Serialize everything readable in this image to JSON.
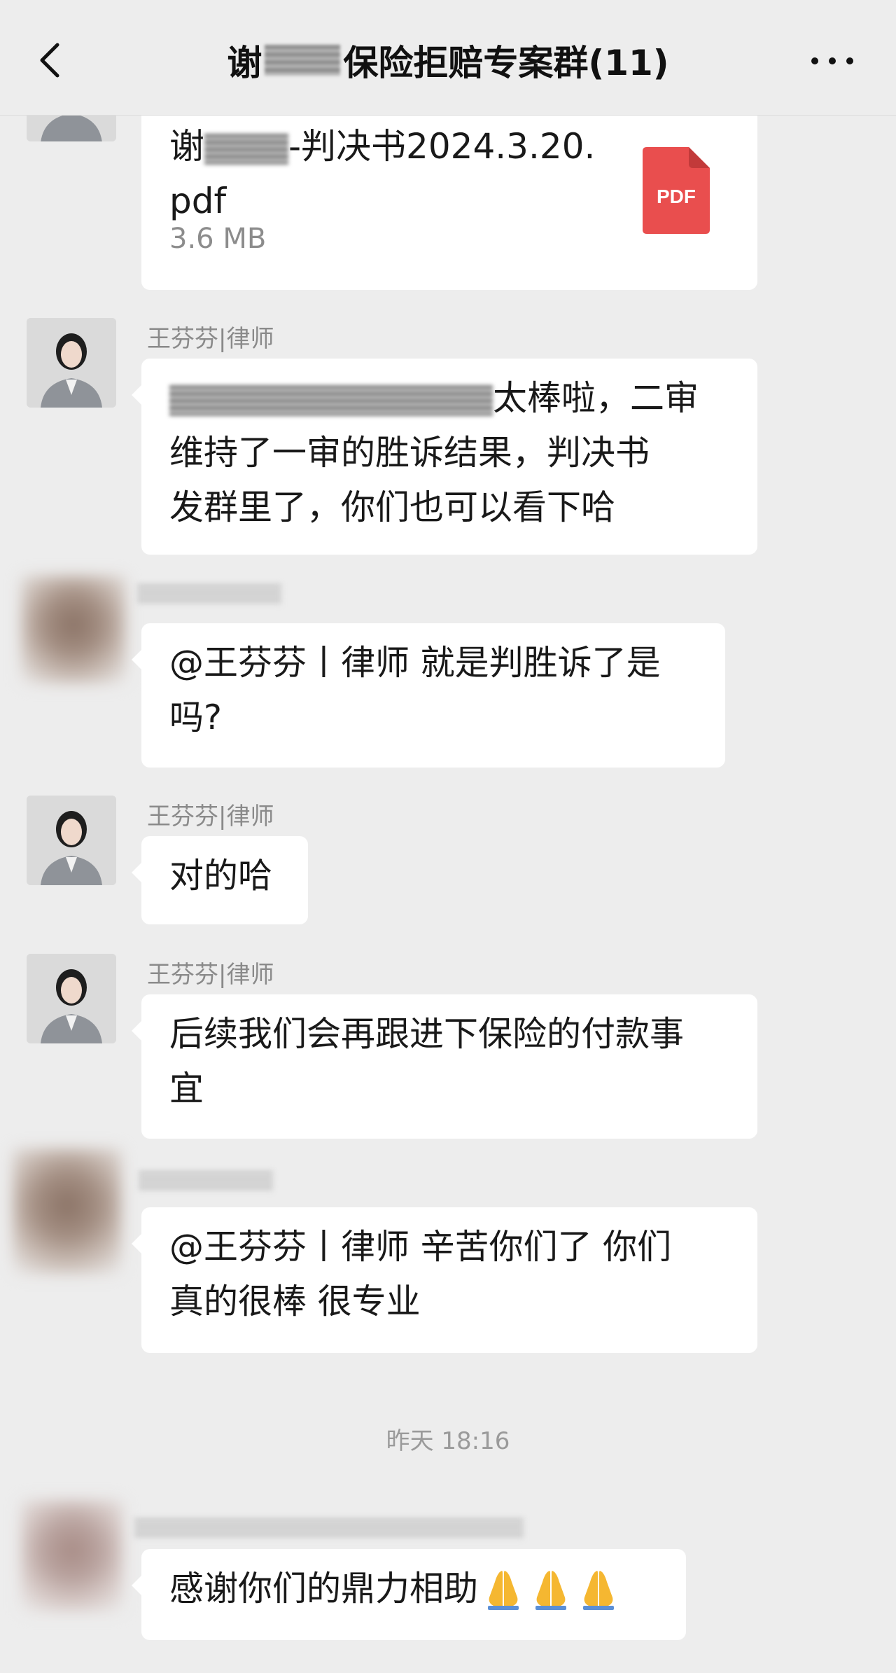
{
  "header": {
    "title_prefix": "谢",
    "title_suffix": "保险拒赔专案群(11)"
  },
  "messages": {
    "file": {
      "name_prefix": "谢",
      "name_line1_rest": "-判决书2024.3.20.",
      "name_line2": "pdf",
      "size": "3.6 MB",
      "icon_label": "PDF"
    },
    "m1": {
      "sender": "王芬芬|律师",
      "line1": "太棒啦，二审",
      "line2": "维持了一审的胜诉结果，判决书",
      "line3": "发群里了，你们也可以看下哈"
    },
    "m2": {
      "line1": "@王芬芬丨律师  就是判胜诉了是",
      "line2": "吗?"
    },
    "m3": {
      "sender": "王芬芬|律师",
      "line1": "对的哈"
    },
    "m4": {
      "sender": "王芬芬|律师",
      "line1": "后续我们会再跟进下保险的付款事",
      "line2": "宜"
    },
    "m5": {
      "line1": "@王芬芬丨律师  辛苦你们了  你们",
      "line2": "真的很棒 很专业"
    },
    "timestamp": "昨天 18:16",
    "m6": {
      "line1": "感谢你们的鼎力相助"
    }
  },
  "colors": {
    "background": "#ededed",
    "bubble": "#ffffff",
    "pdf_red": "#e94e4e",
    "pray_emoji": "#f5b731"
  },
  "icons": [
    "back-arrow-icon",
    "more-icon",
    "pdf-file-icon",
    "pray-emoji-icon"
  ]
}
